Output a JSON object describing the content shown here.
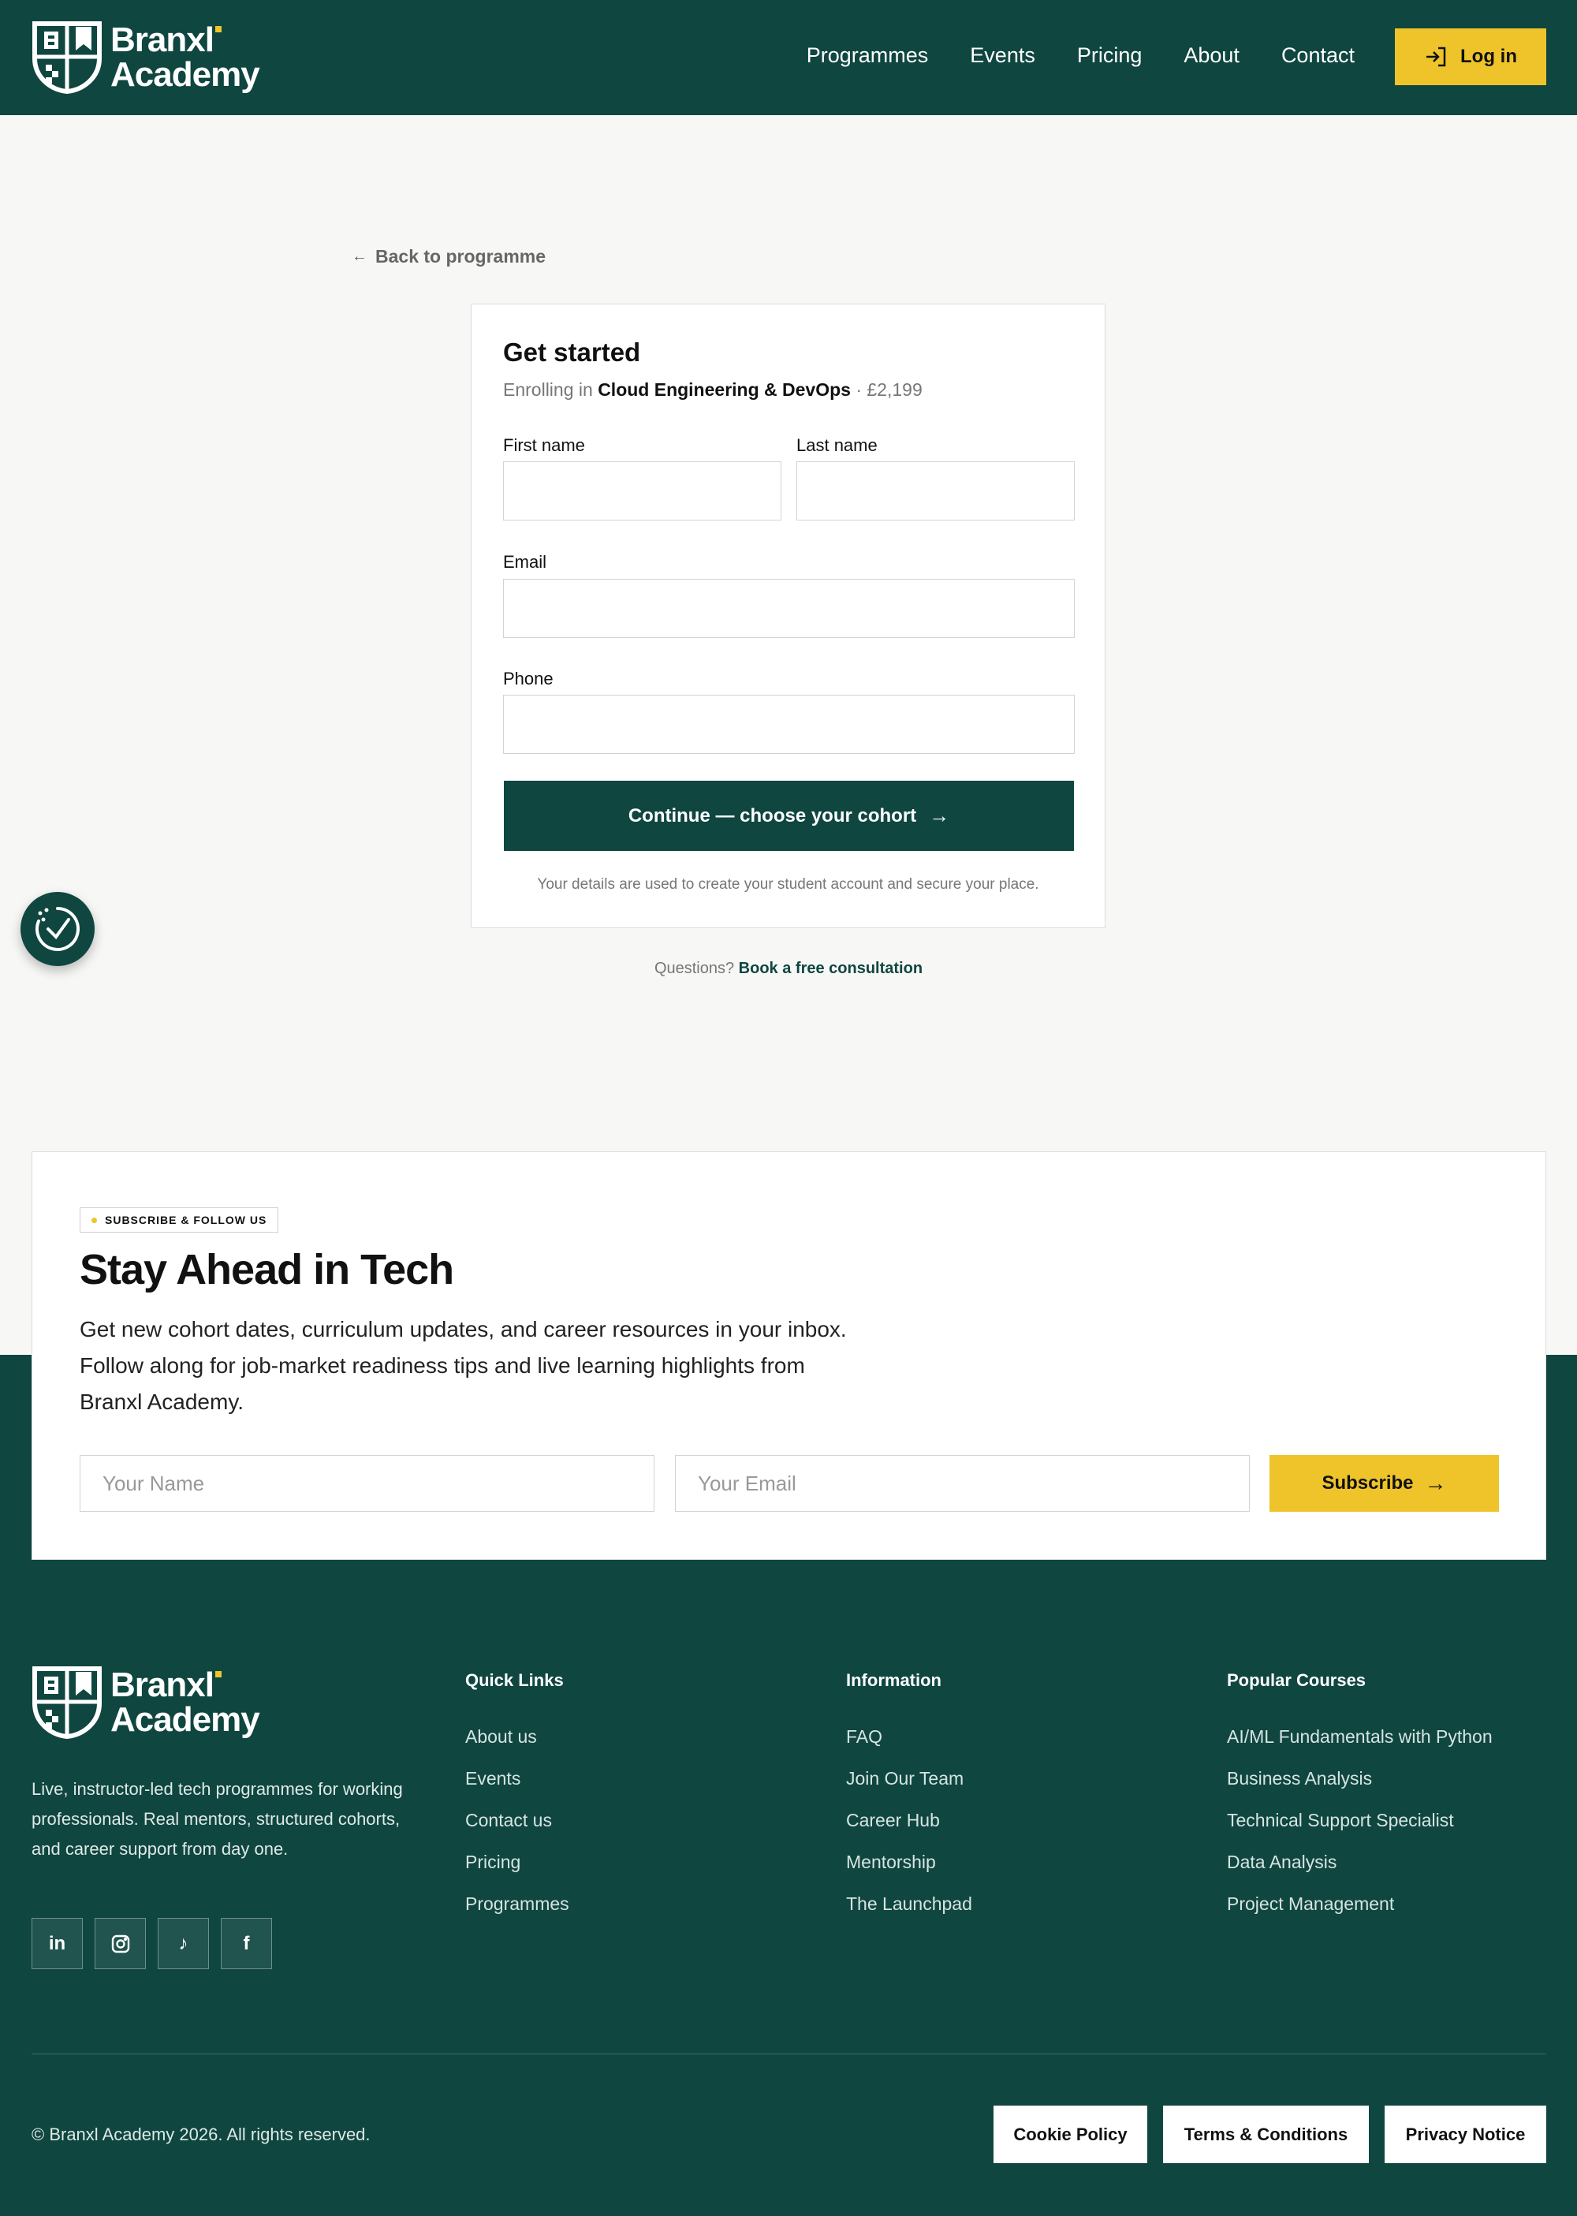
{
  "brand": {
    "line1": "Branxl",
    "line2": "Academy"
  },
  "header": {
    "nav": [
      "Programmes",
      "Events",
      "Pricing",
      "About",
      "Contact"
    ],
    "login_label": "Log in"
  },
  "back_link": "Back to programme",
  "form": {
    "title": "Get started",
    "enrolling_prefix": "Enrolling in",
    "programme": "Cloud Engineering & DevOps",
    "price": "· £2,199",
    "first_name_label": "First name",
    "last_name_label": "Last name",
    "email_label": "Email",
    "phone_label": "Phone",
    "first_name_value": "",
    "last_name_value": "",
    "email_value": "",
    "phone_value": "",
    "continue_label": "Continue — choose your cohort",
    "note": "Your details are used to create your student account and secure your place."
  },
  "questions": {
    "prefix": "Questions?",
    "link": "Book a free consultation"
  },
  "subscribe": {
    "pill": "SUBSCRIBE & FOLLOW US",
    "title": "Stay Ahead in Tech",
    "text": "Get new cohort dates, curriculum updates, and career resources in your inbox. Follow along for job-market readiness tips and live learning highlights from Branxl Academy.",
    "name_placeholder": "Your Name",
    "email_placeholder": "Your Email",
    "button": "Subscribe"
  },
  "footer": {
    "description": "Live, instructor-led tech programmes for working professionals. Real mentors, structured cohorts, and career support from day one.",
    "socials": [
      "linkedin-icon",
      "instagram-icon",
      "tiktok-icon",
      "facebook-icon"
    ],
    "columns": [
      {
        "heading": "Quick Links",
        "links": [
          "About us",
          "Events",
          "Contact us",
          "Pricing",
          "Programmes"
        ]
      },
      {
        "heading": "Information",
        "links": [
          "FAQ",
          "Join Our Team",
          "Career Hub",
          "Mentorship",
          "The Launchpad"
        ]
      },
      {
        "heading": "Popular Courses",
        "links": [
          "AI/ML Fundamentals with Python",
          "Business Analysis",
          "Technical Support Specialist",
          "Data Analysis",
          "Project Management"
        ]
      }
    ],
    "copyright": "© Branxl Academy 2026. All rights reserved.",
    "legal": [
      "Cookie Policy",
      "Terms & Conditions",
      "Privacy Notice"
    ]
  },
  "colors": {
    "primary": "#0f4640",
    "accent": "#eec42a",
    "background": "#f7f7f5"
  }
}
